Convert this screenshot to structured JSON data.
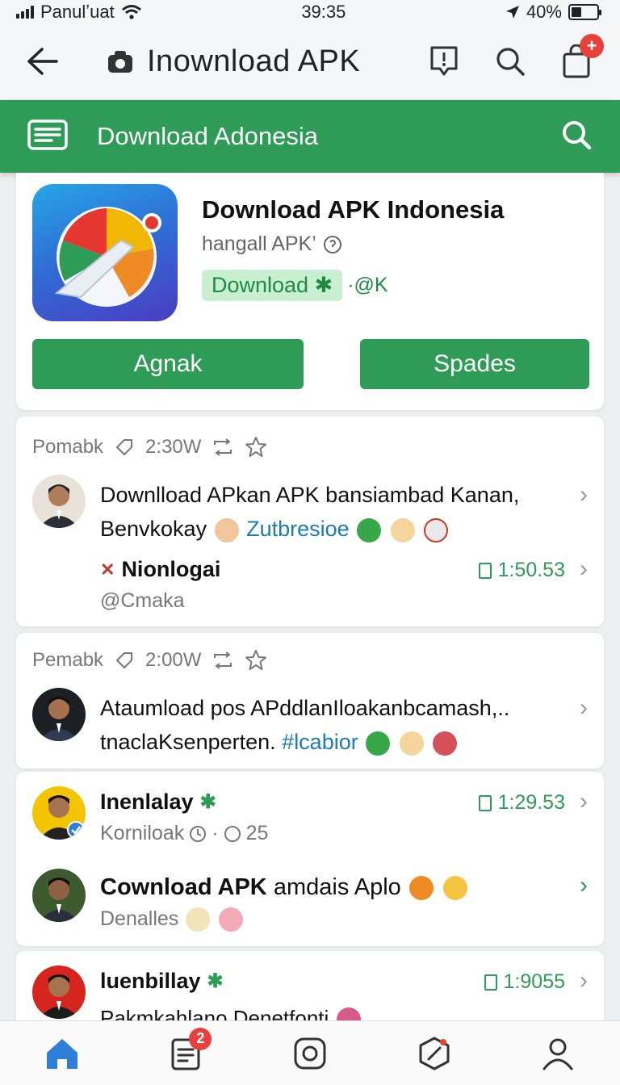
{
  "status_bar": {
    "carrier": "Panulʼuat",
    "time": "39:35",
    "battery": "40%",
    "battery_level": 0.4
  },
  "header": {
    "title": "Inownload APK",
    "icons": [
      "back-arrow-icon",
      "lock-icon",
      "report-icon",
      "search-icon",
      "bag-icon"
    ],
    "notification_badge": "+"
  },
  "greenbar": {
    "title": "Download Adonesia"
  },
  "app": {
    "title": "Download APK Indonesia",
    "subtitle": "hangall APK’",
    "download_tag": "Download ✱",
    "tag_extra": "·@K",
    "primary_button": "Agnak",
    "secondary_button": "Spades"
  },
  "posts": [
    {
      "label": "Pomabk",
      "time_ago": "2:30W",
      "text_line1": "Downlload APkan APK bansiambad Kanan,",
      "text_line2": "Benvkokay",
      "hashtag": "Zutbresioe",
      "author": "Nionlogai",
      "handle": "@Cmaka",
      "duration": "1:50.53"
    },
    {
      "label": "Pemabk",
      "time_ago": "2:00W",
      "text_line1": "Ataumload pos APddlanIloakanbcamash,..",
      "text_line2": "tnaclaKsenperten.",
      "hashtag": "#lcabior"
    },
    {
      "author": "Inenlalay",
      "sub": "Korniloak",
      "count": "25",
      "duration": "1:29.53",
      "title": "Cownload APK",
      "title_rest": "amdais Aplo",
      "sub2": "Denalles"
    },
    {
      "author": "luenbillay",
      "duration": "1:9055",
      "text": "Pakmkahlano Denetfonti"
    }
  ],
  "bottom_nav": {
    "items": [
      "home-icon",
      "news-icon",
      "camera-icon",
      "explore-icon",
      "profile-icon"
    ],
    "news_badge": "2"
  },
  "colors": {
    "primary": "#2e9b57",
    "badge": "#e8403a",
    "hashtag": "#1f7ab8"
  }
}
